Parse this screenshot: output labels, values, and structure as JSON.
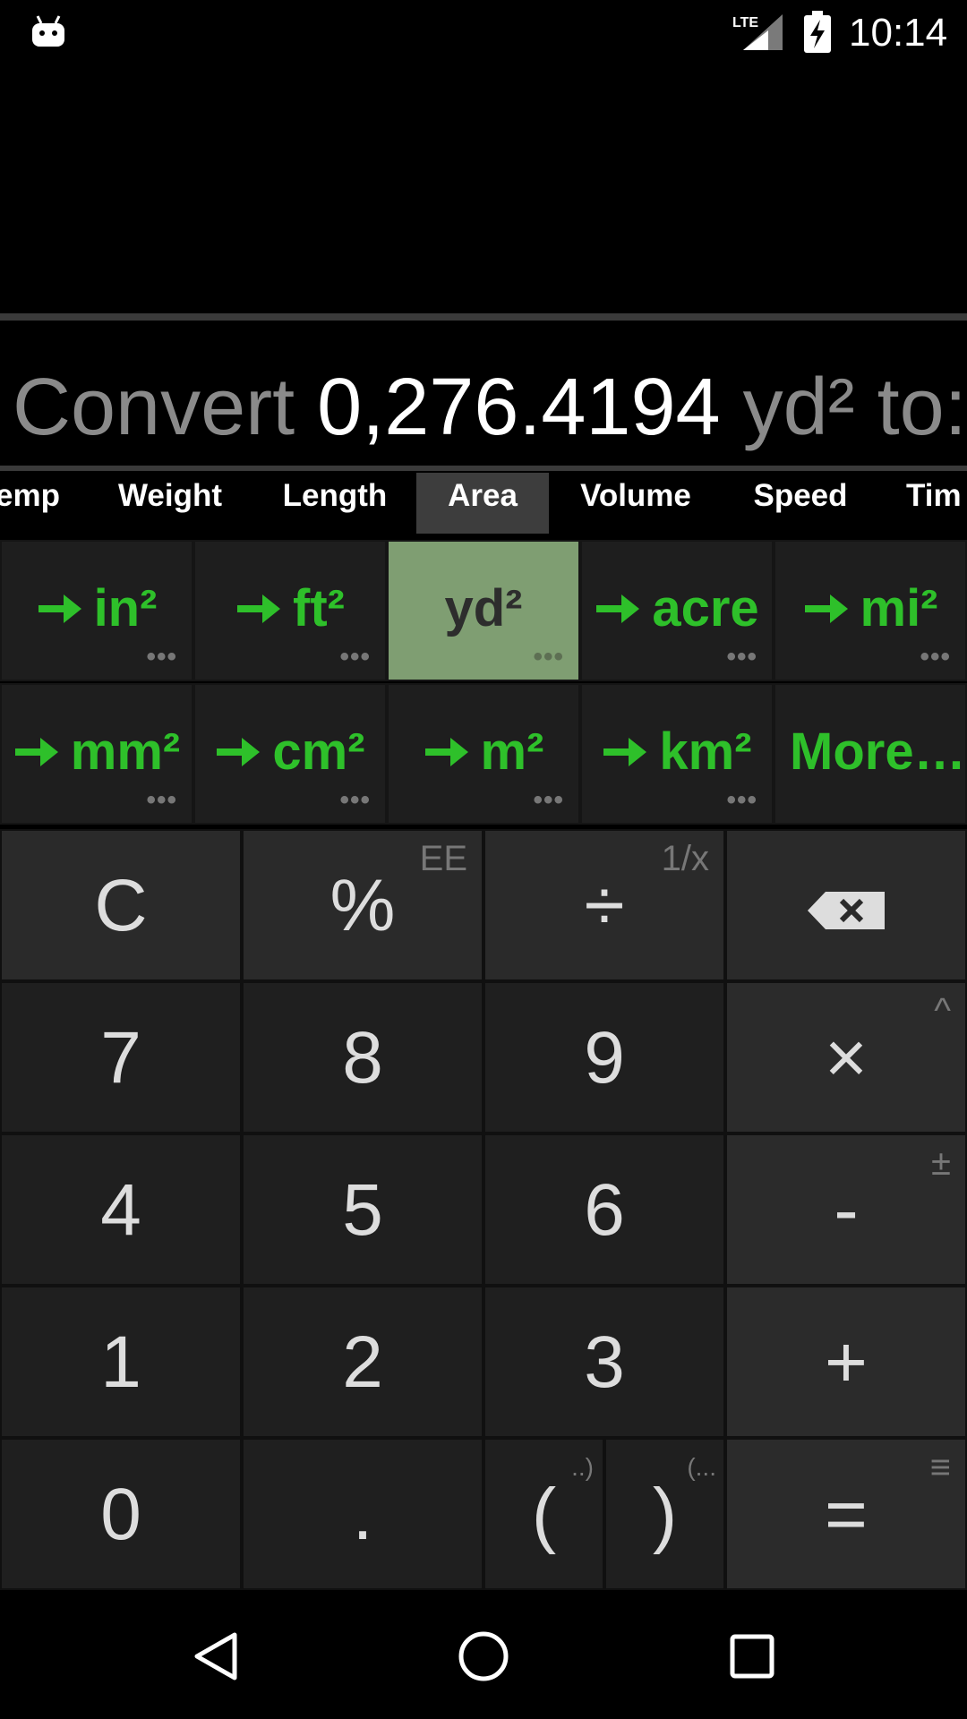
{
  "status_bar": {
    "time": "10:14",
    "icons": [
      "android-notification-icon",
      "lte-signal-icon",
      "battery-charging-icon"
    ]
  },
  "conversion": {
    "prefix": "Convert",
    "value": "0,276.4194",
    "unit": "yd²",
    "suffix": "to:"
  },
  "tabs": [
    {
      "label": "emp"
    },
    {
      "label": "Weight"
    },
    {
      "label": "Length"
    },
    {
      "label": "Area",
      "active": true
    },
    {
      "label": "Volume"
    },
    {
      "label": "Speed"
    },
    {
      "label": "Tim"
    }
  ],
  "units": [
    {
      "label": "in²",
      "arrow": true
    },
    {
      "label": "ft²",
      "arrow": true
    },
    {
      "label": "yd²",
      "arrow": false,
      "selected": true
    },
    {
      "label": "acre",
      "arrow": true
    },
    {
      "label": "mi²",
      "arrow": true
    },
    {
      "label": "mm²",
      "arrow": true
    },
    {
      "label": "cm²",
      "arrow": true
    },
    {
      "label": "m²",
      "arrow": true
    },
    {
      "label": "km²",
      "arrow": true
    },
    {
      "label": "More…",
      "arrow": false
    }
  ],
  "unit_dots": "•••",
  "keys": {
    "clear": "C",
    "percent": "%",
    "percent_alt": "EE",
    "divide": "÷",
    "divide_alt": "1/x",
    "seven": "7",
    "eight": "8",
    "nine": "9",
    "multiply": "×",
    "multiply_alt": "^",
    "four": "4",
    "five": "5",
    "six": "6",
    "minus": "-",
    "minus_alt": "±",
    "one": "1",
    "two": "2",
    "three": "3",
    "plus": "+",
    "zero": "0",
    "dot": ".",
    "open_paren": "(",
    "open_paren_alt": "..)",
    "close_paren": ")",
    "close_paren_alt": "(...",
    "equals": "=",
    "equals_alt": "≡"
  },
  "colors": {
    "accent_green": "#2ec02a",
    "selected_unit_bg": "#7f9e72",
    "key_bg": "#1f1f1f",
    "background": "#000000"
  }
}
